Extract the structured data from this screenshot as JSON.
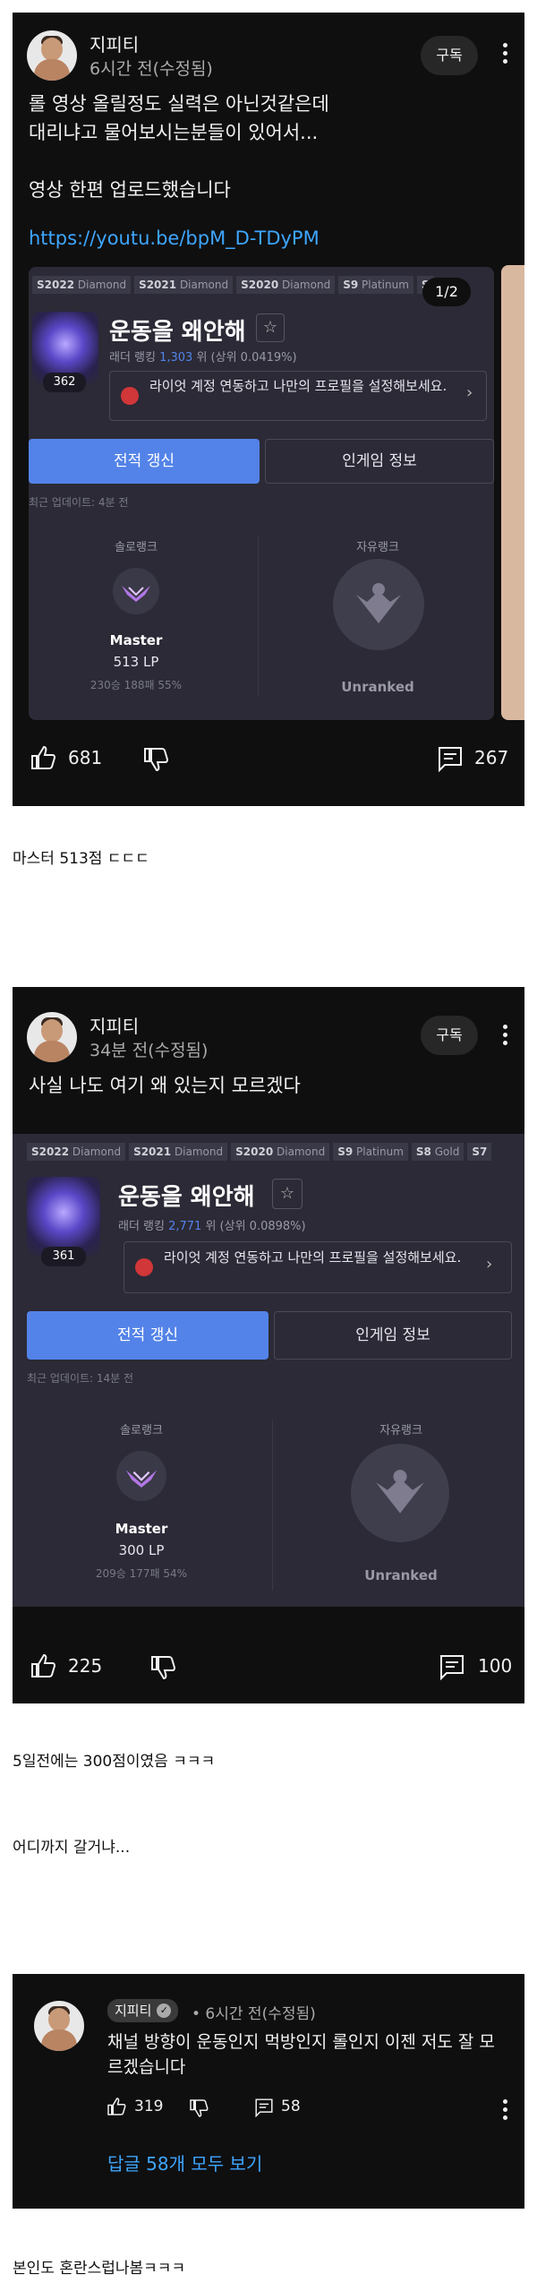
{
  "post1": {
    "channel": "지피티",
    "time": "6시간 전(수정됨)",
    "subscribe": "구독",
    "text": "롤 영상 올릴정도 실력은 아닌것같은데\n대리냐고 물어보시는분들이 있어서...\n\n영상 한편 업로드했습니다",
    "link": "https://youtu.be/bpM_D-TDyPM",
    "pager": "1/2",
    "card": {
      "seasons": [
        {
          "year": "S2022",
          "tier": "Diamond"
        },
        {
          "year": "S2021",
          "tier": "Diamond"
        },
        {
          "year": "S2020",
          "tier": "Diamond"
        },
        {
          "year": "S9",
          "tier": "Platinum"
        },
        {
          "year": "S",
          "tier": ""
        }
      ],
      "level": "362",
      "summoner": "운동을 왜안해",
      "ladder_prefix": "래더 랭킹 ",
      "ladder_rank": "1,303",
      "ladder_suffix": " 위 (상위 0.0419%)",
      "riot_notice": "라이엇 계정 연동하고 나만의 프로필을 설정해보세요.",
      "btn_refresh": "전적 갱신",
      "btn_ingame": "인게임 정보",
      "updated": "최근 업데이트: 4분 전",
      "solo_label": "솔로랭크",
      "solo_tier": "Master",
      "solo_lp": "513 LP",
      "solo_wl": "230승 188패 55%",
      "flex_label": "자유랭크",
      "flex_tier": "Unranked"
    },
    "likes": "681",
    "comments": "267"
  },
  "caption1": "마스터 513점 ㄷㄷㄷ",
  "post2": {
    "channel": "지피티",
    "time": "34분 전(수정됨)",
    "subscribe": "구독",
    "text": "사실 나도 여기 왜 있는지 모르겠다",
    "card": {
      "seasons": [
        {
          "year": "S2022",
          "tier": "Diamond"
        },
        {
          "year": "S2021",
          "tier": "Diamond"
        },
        {
          "year": "S2020",
          "tier": "Diamond"
        },
        {
          "year": "S9",
          "tier": "Platinum"
        },
        {
          "year": "S8",
          "tier": "Gold"
        },
        {
          "year": "S7",
          "tier": ""
        }
      ],
      "level": "361",
      "summoner": "운동을 왜안해",
      "ladder_prefix": "래더 랭킹 ",
      "ladder_rank": "2,771",
      "ladder_suffix": " 위 (상위 0.0898%)",
      "riot_notice": "라이엇 계정 연동하고 나만의 프로필을 설정해보세요.",
      "btn_refresh": "전적 갱신",
      "btn_ingame": "인게임 정보",
      "updated": "최근 업데이트: 14분 전",
      "solo_label": "솔로랭크",
      "solo_tier": "Master",
      "solo_lp": "300 LP",
      "solo_wl": "209승 177패 54%",
      "flex_label": "자유랭크",
      "flex_tier": "Unranked"
    },
    "likes": "225",
    "comments": "100"
  },
  "caption2": "5일전에는 300점이였음 ㅋㅋㅋ",
  "caption3": "어디까지 갈거냐...",
  "comment": {
    "channel": "지피티",
    "time": "• 6시간 전(수정됨)",
    "text": "채널 방향이 운동인지 먹방인지 롤인지 이젠 저도 잘 모르겠습니다",
    "likes": "319",
    "replies_count": "58",
    "view_replies": "답글 58개 모두 보기"
  },
  "caption4": "본인도 혼란스럽나봄ㅋㅋㅋ",
  "colors": {
    "dark_bg": "#0f0f0f",
    "card_bg": "#2b2a36",
    "accent_blue": "#5383e8",
    "link_blue": "#3ea6ff"
  }
}
